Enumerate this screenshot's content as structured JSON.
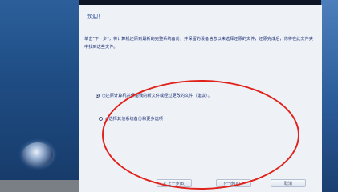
{
  "window": {
    "title": "欢迎！"
  },
  "intro": {
    "text": "单击\"下一步\"，将计算机还原到最新的完整系统备份，并保留的设备信息以来选择还原的文件，还原完成后，你将在此文件夹中找到这些文件。"
  },
  "options": [
    {
      "label": "○还原计算机并保留我的新文件或经过更改的文件（建议）。",
      "checked": true
    },
    {
      "label": "○选择其他系统备份和更多选项",
      "checked": false
    }
  ],
  "buttons": {
    "back": "< 上一步(B)",
    "next": "下一步(N) >",
    "cancel": "取消"
  },
  "colors": {
    "highlight": "#e0231b",
    "accent_text": "#2b4e9a"
  }
}
